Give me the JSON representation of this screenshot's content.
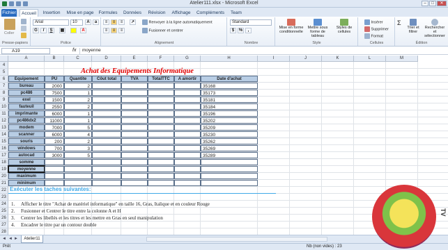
{
  "window": {
    "title": "Atelier111.xlsx - Microsoft Excel"
  },
  "tabs": [
    "Fichier",
    "Accueil",
    "Insertion",
    "Mise en page",
    "Formules",
    "Données",
    "Révision",
    "Affichage",
    "Compléments",
    "Team"
  ],
  "ribbon": {
    "paste": "Coller",
    "clipboard": "Presse-papiers",
    "font_name": "Arial",
    "font_size": "10",
    "police": "Police",
    "wrap": "Renvoyer à la ligne automatiquement",
    "merge": "Fusionner et centrer",
    "alignment": "Alignement",
    "number_format": "Standard",
    "nombre": "Nombre",
    "cond": "Mise en forme conditionnelle",
    "table": "Mettre sous forme de tableau",
    "styles": "Styles de cellules",
    "style": "Style",
    "insert": "Insérer",
    "delete": "Supprimer",
    "format": "Format",
    "cells": "Cellules",
    "sort": "Trier et filtrer",
    "find": "Rechercher et sélectionner",
    "edition": "Édition",
    "sum": "Σ"
  },
  "formula_bar": {
    "name_box": "A19",
    "fx": "fx",
    "content": "moyenne"
  },
  "columns": [
    "A",
    "B",
    "C",
    "D",
    "E",
    "F",
    "G",
    "H",
    "I",
    "J",
    "K",
    "L",
    "M"
  ],
  "rows": [
    "4",
    "5",
    "6",
    "7",
    "8",
    "9",
    "10",
    "11",
    "12",
    "13",
    "14",
    "15",
    "16",
    "17",
    "18",
    "19",
    "20",
    "21",
    "22",
    "23",
    "24",
    "25",
    "26",
    "27",
    "28"
  ],
  "sheet": {
    "title": "Achat des Equipements Informatique",
    "headers": [
      "Equipement",
      "PU",
      "Quantite",
      "Côut total",
      "TVA",
      "TotalTTC",
      "A amortir",
      "Date d'achat"
    ],
    "items": [
      {
        "name": "bureau",
        "pu": "2000",
        "qty": "2",
        "date": "35168"
      },
      {
        "name": "pc486",
        "pu": "7500",
        "qty": "1",
        "date": "35173"
      },
      {
        "name": "exel",
        "pu": "1500",
        "qty": "2",
        "date": "35181"
      },
      {
        "name": "fauteuil",
        "pu": "2550",
        "qty": "2",
        "date": "35184"
      },
      {
        "name": "imprimante",
        "pu": "6000",
        "qty": "1",
        "date": "35196"
      },
      {
        "name": "pc486dx2",
        "pu": "11000",
        "qty": "1",
        "date": "35202"
      },
      {
        "name": "modem",
        "pu": "7000",
        "qty": "5",
        "date": "35209"
      },
      {
        "name": "scanner",
        "pu": "6000",
        "qty": "4",
        "date": "35230"
      },
      {
        "name": "souris",
        "pu": "200",
        "qty": "2",
        "date": "35262"
      },
      {
        "name": "windows",
        "pu": "700",
        "qty": "3",
        "date": "35269"
      },
      {
        "name": "autocad",
        "pu": "3000",
        "qty": "5",
        "date": "35289"
      }
    ],
    "summary": [
      "somme",
      "moyenne",
      "maximum",
      "minimum"
    ],
    "tasks_title": "Exécuter les taches suivantes:",
    "tasks": [
      {
        "n": "1.",
        "text": "Afficher le titre \"Achat de matériel informatique\" en taille 16, Gras, Italique et en couleur Rouge"
      },
      {
        "n": "2.",
        "text": "Fusionner et Centrer  le titre entre la colonne A et H"
      },
      {
        "n": "3.",
        "text": "Centrer les libellés et les titres et les mettre en Gras en seul manipulation"
      },
      {
        "n": "4.",
        "text": "Encadrer le titre par un contour double"
      }
    ]
  },
  "sheet_tab": "Atelier11",
  "status": {
    "left": "Prêt",
    "right": "Nb (non vides) : 23"
  },
  "watermark": "TV"
}
